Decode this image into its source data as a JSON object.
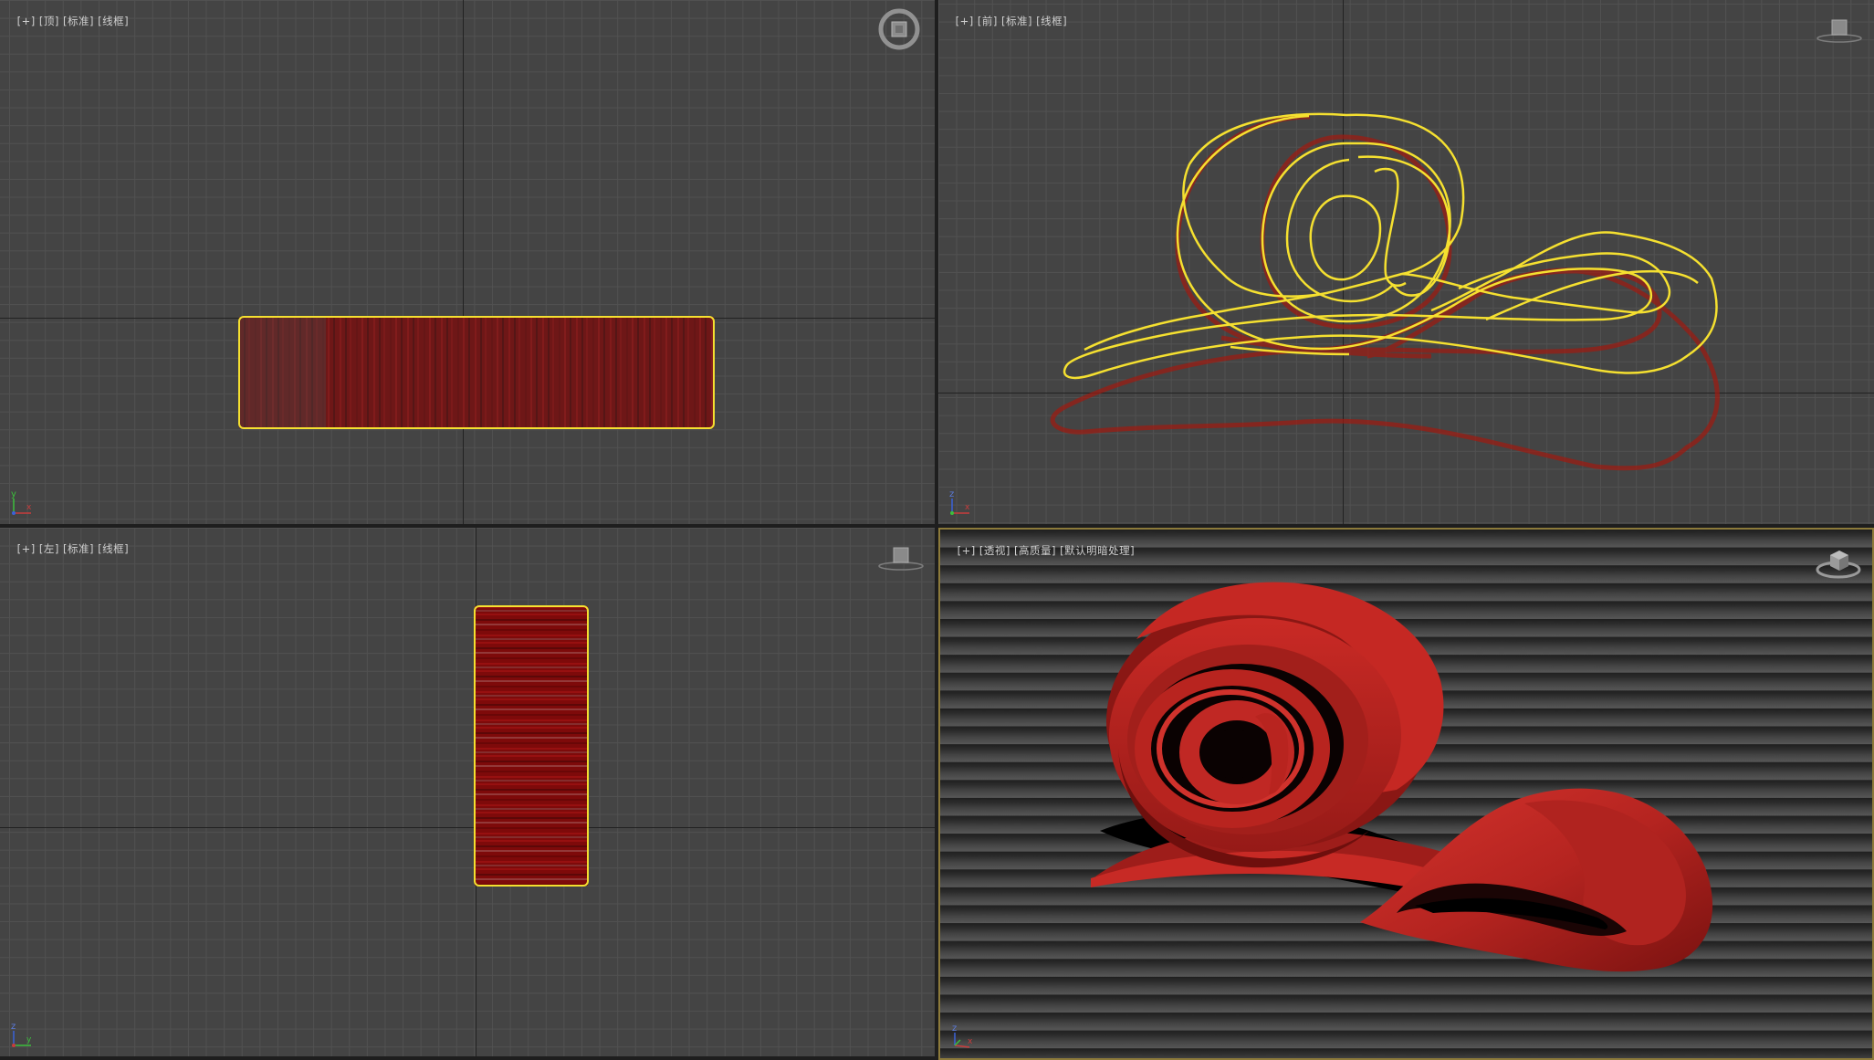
{
  "viewports": {
    "top": {
      "labels": [
        "[+]",
        "[顶]",
        "[标准]",
        "[线框]"
      ]
    },
    "front": {
      "labels": [
        "[+]",
        "[前]",
        "[标准]",
        "[线框]"
      ]
    },
    "left": {
      "labels": [
        "[+]",
        "[左]",
        "[标准]",
        "[线框]"
      ]
    },
    "persp": {
      "labels": [
        "[+]",
        "[透视]",
        "[高质量]",
        "[默认明暗处理]"
      ]
    }
  },
  "axis_labels": {
    "top": [
      "y",
      "x"
    ],
    "front": [
      "z",
      "x"
    ],
    "left": [
      "z",
      "y"
    ],
    "persp": [
      "z",
      "x"
    ]
  },
  "colors": {
    "selection_outline": "#f5e030",
    "wire_red": "#8a0000",
    "object_red": "#c22a26",
    "active_border": "#8c7a3a"
  },
  "icons": {
    "top": "viewcube-top-icon",
    "front": "viewcube-front-icon",
    "left": "viewcube-left-icon",
    "persp": "viewcube-perspective-icon"
  }
}
